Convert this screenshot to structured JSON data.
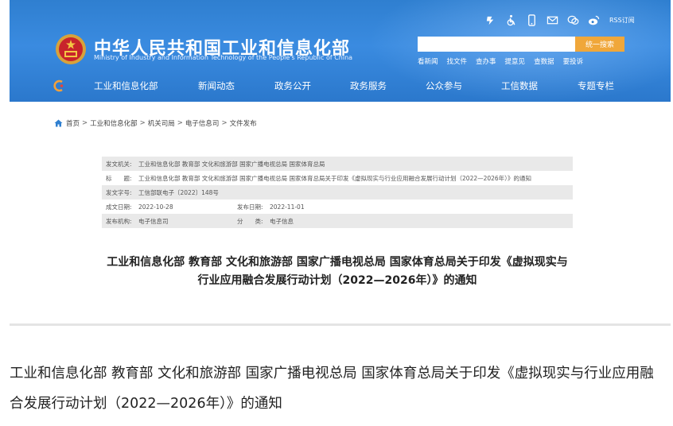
{
  "header": {
    "title": "中华人民共和国工业和信息化部",
    "subtitle": "Ministry of Industry and Information Technology of the People's Republic of China",
    "top_icons": [
      "accessibility-icon",
      "wheelchair-icon",
      "mobile-icon",
      "mail-icon",
      "chat-icon",
      "weibo-icon"
    ],
    "rss_label": "RSS订阅",
    "search_placeholder": "",
    "search_button": "统一搜索",
    "quick_links": [
      "看新闻",
      "找文件",
      "查办事",
      "提意见",
      "查数据",
      "要投诉"
    ],
    "nav_items": [
      "工业和信息化部",
      "新闻动态",
      "政务公开",
      "政务服务",
      "公众参与",
      "工信数据",
      "专题专栏"
    ]
  },
  "breadcrumb": [
    "首页",
    "工业和信息化部",
    "机关司局",
    "电子信息司",
    "文件发布"
  ],
  "info": {
    "issuer_label": "发文机关:",
    "issuer_value": "工业和信息化部 教育部 文化和旅游部 国家广播电视总局 国家体育总局",
    "title_label": "标　　题:",
    "title_value": "工业和信息化部 教育部 文化和旅游部 国家广播电视总局 国家体育总局关于印发《虚拟现实与行业应用融合发展行动计划（2022—2026年）》的通知",
    "docno_label": "发文字号:",
    "docno_value": "工信部联电子〔2022〕148号",
    "created_label": "成文日期:",
    "created_value": "2022-10-28",
    "published_label": "发布日期:",
    "published_value": "2022-11-01",
    "agency_label": "发布机构:",
    "agency_value": "电子信息司",
    "category_label": "分　　类:",
    "category_value": "电子信息"
  },
  "doc_title": "工业和信息化部 教育部 文化和旅游部 国家广播电视总局 国家体育总局关于印发《虚拟现实与行业应用融合发展行动计划（2022—2026年）》的通知",
  "caption": "工业和信息化部 教育部 文化和旅游部 国家广播电视总局 国家体育总局关于印发《虚拟现实与行业应用融合发展行动计划（2022—2026年）》的通知",
  "colors": {
    "header_blue": "#2f7fd0",
    "search_button": "#f0a73a",
    "table_shade": "#e9e9e9"
  }
}
